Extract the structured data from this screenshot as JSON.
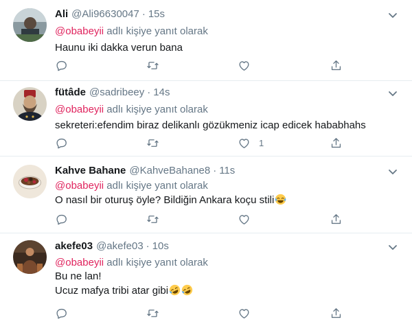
{
  "colors": {
    "mention": "#e0245e",
    "secondary": "#657786",
    "divider": "#e6ecf0"
  },
  "replying_prefix": "",
  "tweets": [
    {
      "name": "Ali",
      "handle": "@Ali96630047",
      "separator": "·",
      "time": "15s",
      "mention": "@obabeyii",
      "reply_suffix": "adlı kişiye yanıt olarak",
      "lines": [
        "Haunu iki dakka verun bana"
      ],
      "like_count": "",
      "avatar_icon": "avatar-photo-icon",
      "emojis": []
    },
    {
      "name": "fütâde",
      "handle": "@sadribeey",
      "separator": "·",
      "time": "14s",
      "mention": "@obabeyii",
      "reply_suffix": "adlı kişiye yanıt olarak",
      "lines": [
        "sekreteri:efendim biraz delikanlı gözükmeniz icap edicek hababhahs"
      ],
      "like_count": "1",
      "avatar_icon": "avatar-portrait-icon",
      "emojis": []
    },
    {
      "name": "Kahve Bahane",
      "handle": "@KahveBahane8",
      "separator": "·",
      "time": "11s",
      "mention": "@obabeyii",
      "reply_suffix": "adlı kişiye yanıt olarak",
      "lines": [
        "O nasıl bir oturuş öyle? Bildiğin Ankara koçu stili"
      ],
      "like_count": "",
      "avatar_icon": "avatar-coffee-icon",
      "emojis": [
        "laughing-tears-emoji"
      ]
    },
    {
      "name": "akefe03",
      "handle": "@akefe03",
      "separator": "·",
      "time": "10s",
      "mention": "@obabeyii",
      "reply_suffix": "adlı kişiye yanıt olarak",
      "lines": [
        "Bu ne lan!",
        "Ucuz mafya tribi atar gibi"
      ],
      "like_count": "",
      "avatar_icon": "avatar-figure-icon",
      "emojis": [
        "rolling-laughing-emoji",
        "rolling-laughing-emoji"
      ]
    }
  ],
  "icons": {
    "reply": "reply-icon",
    "retweet": "retweet-icon",
    "like": "like-icon",
    "share": "share-icon",
    "caret": "chevron-down-icon"
  }
}
